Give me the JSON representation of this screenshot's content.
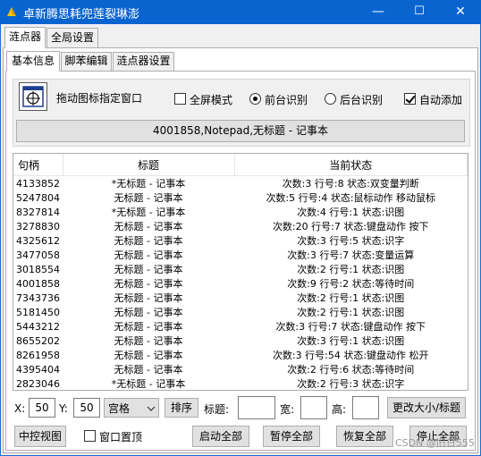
{
  "window": {
    "title": "卓新腾思耗兜莲裂琳澎",
    "minimize": "—",
    "maximize": "☐",
    "close": "✕"
  },
  "tabs_outer": [
    "涟点器",
    "全局设置"
  ],
  "tabs_inner": [
    "基本信息",
    "脚苯编辑",
    "涟点器设置"
  ],
  "top": {
    "drag_label": "拖动图标指定窗口",
    "fullscreen_label": "全屏模式",
    "foreground_label": "前台识别",
    "background_label": "后台识别",
    "autoadd_label": "自动添加",
    "window_info": "4001858,Notepad,无标题 - 记事本"
  },
  "table": {
    "headers": [
      "句柄",
      "标题",
      "当前状态"
    ],
    "rows": [
      [
        "4133852",
        "*无标题 - 记事本",
        "次数:3 行号:8 状态:双变量判断"
      ],
      [
        "5247804",
        "无标题 - 记事本",
        "次数:5 行号:4 状态:鼠标动作 移动鼠标"
      ],
      [
        "8327814",
        "*无标题 - 记事本",
        "次数:4 行号:1 状态:识图"
      ],
      [
        "3278830",
        "无标题 - 记事本",
        "次数:20 行号:7 状态:键盘动作 按下"
      ],
      [
        "4325612",
        "无标题 - 记事本",
        "次数:3 行号:5 状态:识字"
      ],
      [
        "3477058",
        "无标题 - 记事本",
        "次数:3 行号:7 状态:变量运算"
      ],
      [
        "3018554",
        "无标题 - 记事本",
        "次数:2 行号:1 状态:识图"
      ],
      [
        "4001858",
        "无标题 - 记事本",
        "次数:9 行号:2 状态:等待时间"
      ],
      [
        "7343736",
        "无标题 - 记事本",
        "次数:2 行号:1 状态:识图"
      ],
      [
        "5181450",
        "无标题 - 记事本",
        "次数:2 行号:1 状态:识图"
      ],
      [
        "5443212",
        "无标题 - 记事本",
        "次数:3 行号:7 状态:键盘动作 按下"
      ],
      [
        "8655202",
        "无标题 - 记事本",
        "次数:3 行号:1 状态:识图"
      ],
      [
        "8261958",
        "无标题 - 记事本",
        "次数:3 行号:54 状态:键盘动作 松开"
      ],
      [
        "4395404",
        "无标题 - 记事本",
        "次数:2 行号:6 状态:等待时间"
      ],
      [
        "2823046",
        "*无标题 - 记事本",
        "次数:2 行号:3 状态:识字"
      ]
    ]
  },
  "bottom": {
    "x_label": "X:",
    "x_value": "50",
    "y_label": "Y:",
    "y_value": "50",
    "layout_select": "宫格",
    "sort_button": "排序",
    "title_label": "标题:",
    "title_value": "",
    "width_label": "宽:",
    "width_value": "",
    "height_label": "高:",
    "height_value": "",
    "resize_button": "更改大小/标题",
    "center_view_button": "中控视图",
    "topmost_label": "窗口置顶",
    "start_all_button": "启动全部",
    "pause_all_button": "暂停全部",
    "resume_all_button": "恢复全部",
    "stop_all_button": "停止全部",
    "watermark": "CSDN @旧日555"
  }
}
